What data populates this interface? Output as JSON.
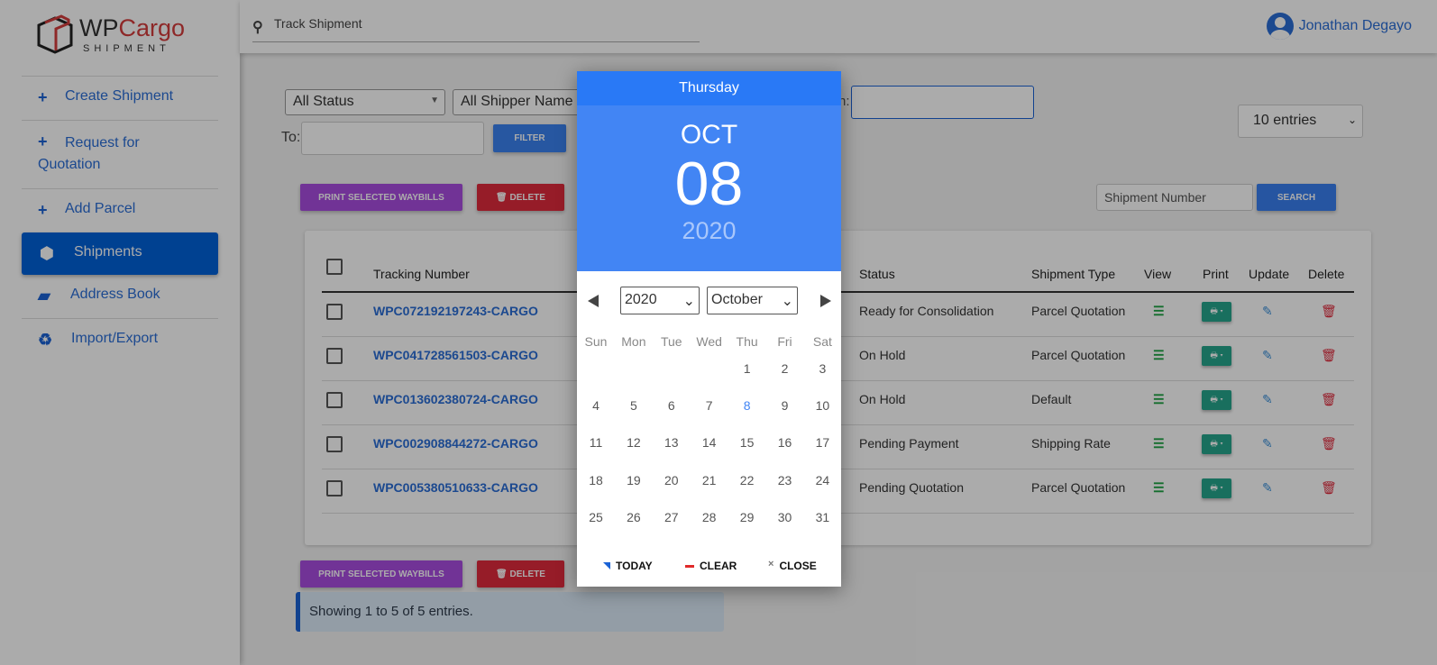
{
  "logo": {
    "brand_a": "WP",
    "brand_b": "Cargo",
    "sub": "SHIPMENT"
  },
  "sidebar": {
    "items": [
      {
        "label": "Create Shipment",
        "icon": "plus-icon"
      },
      {
        "label": "Request for Quotation",
        "icon": "plus-icon"
      },
      {
        "label": "Add Parcel",
        "icon": "plus-icon"
      },
      {
        "label": "Shipments",
        "icon": "cubes-icon",
        "active": true
      },
      {
        "label": "Address Book",
        "icon": "book-icon"
      },
      {
        "label": "Import/Export",
        "icon": "recycle-icon"
      }
    ]
  },
  "topbar": {
    "track_placeholder": "Track Shipment",
    "user": "Jonathan Degayo"
  },
  "filters": {
    "status": "All Status",
    "shipper": "All Shipper Name",
    "from_label": "n:",
    "to_label": "To:",
    "filter_btn": "FILTER",
    "entries": "10 entries",
    "search_placeholder": "Shipment Number",
    "search_btn": "SEARCH"
  },
  "actions": {
    "print": "PRINT SELECTED WAYBILLS",
    "delete": "DELETE"
  },
  "table": {
    "headers": [
      "Tracking Number",
      "Status",
      "Shipment Type",
      "View",
      "Print",
      "Update",
      "Delete"
    ],
    "rows": [
      {
        "tracking": "WPC072192197243-CARGO",
        "status": "Ready for Consolidation",
        "type": "Parcel Quotation"
      },
      {
        "tracking": "WPC041728561503-CARGO",
        "status": "On Hold",
        "type": "Parcel Quotation"
      },
      {
        "tracking": "WPC013602380724-CARGO",
        "status": "On Hold",
        "type": "Default"
      },
      {
        "tracking": "WPC002908844272-CARGO",
        "status": "Pending Payment",
        "type": "Shipping Rate"
      },
      {
        "tracking": "WPC005380510633-CARGO",
        "status": "Pending Quotation",
        "type": "Parcel Quotation"
      }
    ]
  },
  "info": "Showing 1 to 5 of 5 entries.",
  "datepicker": {
    "weekday": "Thursday",
    "month_short": "OCT",
    "day": "08",
    "year": "2020",
    "year_select": "2020",
    "month_select": "October",
    "dow": [
      "Sun",
      "Mon",
      "Tue",
      "Wed",
      "Thu",
      "Fri",
      "Sat"
    ],
    "first_dow": 4,
    "days_in_month": 31,
    "selected": 8,
    "today": "TODAY",
    "clear": "CLEAR",
    "close": "CLOSE"
  },
  "colors": {
    "primary": "#4285f4",
    "accent": "#0062d8",
    "purple": "#a94ce0",
    "danger": "#e02a3c",
    "teal": "#26a68d"
  }
}
